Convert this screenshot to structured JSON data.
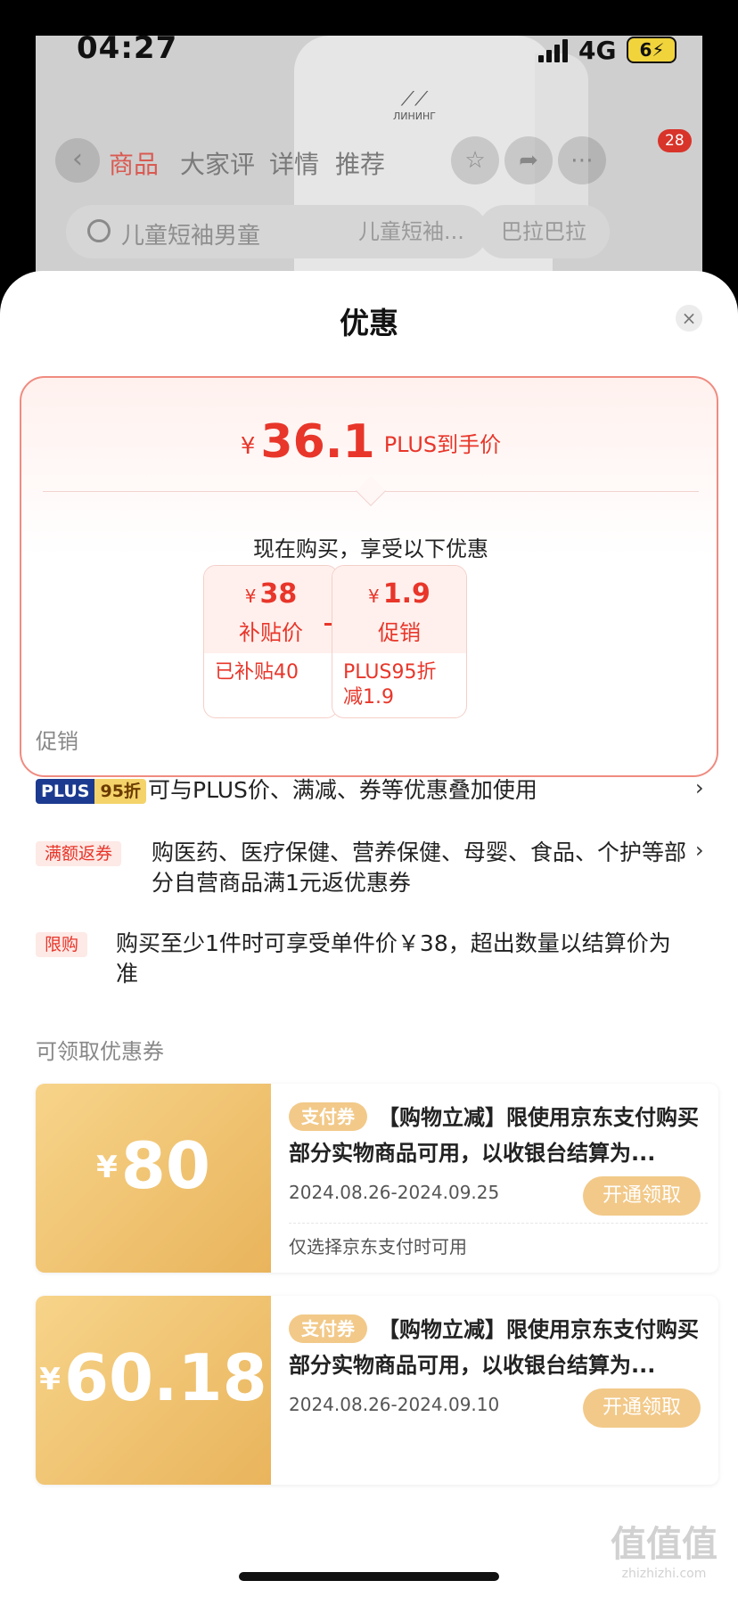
{
  "status_bar": {
    "time": "04:27",
    "network": "4G",
    "battery": "6"
  },
  "background_page": {
    "logo_text": "ЛИНИНГ",
    "tabs": [
      "商品",
      "大家评",
      "详情",
      "推荐"
    ],
    "badge_count": "28",
    "search_placeholder": "儿童短袖男童",
    "chips": [
      "儿童短袖...",
      "巴拉巴拉"
    ]
  },
  "sheet": {
    "title": "优惠",
    "close_label": "×",
    "price": {
      "currency": "¥",
      "amount": "36.1",
      "label": "PLUS到手价"
    },
    "enjoy_text": "现在购买，享受以下优惠",
    "deals": [
      {
        "currency": "¥",
        "value": "38",
        "label": "补贴价",
        "detail": "已补贴40"
      },
      {
        "currency": "¥",
        "value": "1.9",
        "label": "促销",
        "detail": "PLUS95折减1.9"
      }
    ],
    "promo_section_label": "促销",
    "promotions": [
      {
        "tag_a": "PLUS",
        "tag_b": "95折",
        "text": "可与PLUS价、满减、券等优惠叠加使用",
        "chevron": "›"
      },
      {
        "tag": "满额返券",
        "text": "购医药、医疗保健、营养保健、母婴、食品、个护等部分自营商品满1元返优惠券",
        "chevron": "›"
      },
      {
        "tag": "限购",
        "text": "购买至少1件时可享受单件价￥38，超出数量以结算价为准"
      }
    ],
    "coupon_section_label": "可领取优惠券",
    "coupons": [
      {
        "currency": "¥",
        "value": "80",
        "tag": "支付券",
        "title": "【购物立减】限使用京东支付购买部分实物商品可用，以收银台结算为...",
        "dates": "2024.08.26-2024.09.25",
        "note": "仅选择京东支付时可用",
        "button": "开通领取"
      },
      {
        "currency": "¥",
        "value": "60.18",
        "tag": "支付券",
        "title": "【购物立减】限使用京东支付购买部分实物商品可用，以收银台结算为...",
        "dates": "2024.08.26-2024.09.10",
        "note": "",
        "button": "开通领取"
      }
    ]
  },
  "watermark": {
    "big": "值值值",
    "small": "zhizhizhi.com"
  },
  "colors": {
    "accent_red": "#e8362a",
    "coupon_gold": "#e9b45c",
    "plus_blue": "#1c3a8f"
  },
  "icons": [
    "back-icon",
    "star-icon",
    "share-icon",
    "more-icon",
    "search-icon",
    "close-icon",
    "chevron-right-icon"
  ]
}
